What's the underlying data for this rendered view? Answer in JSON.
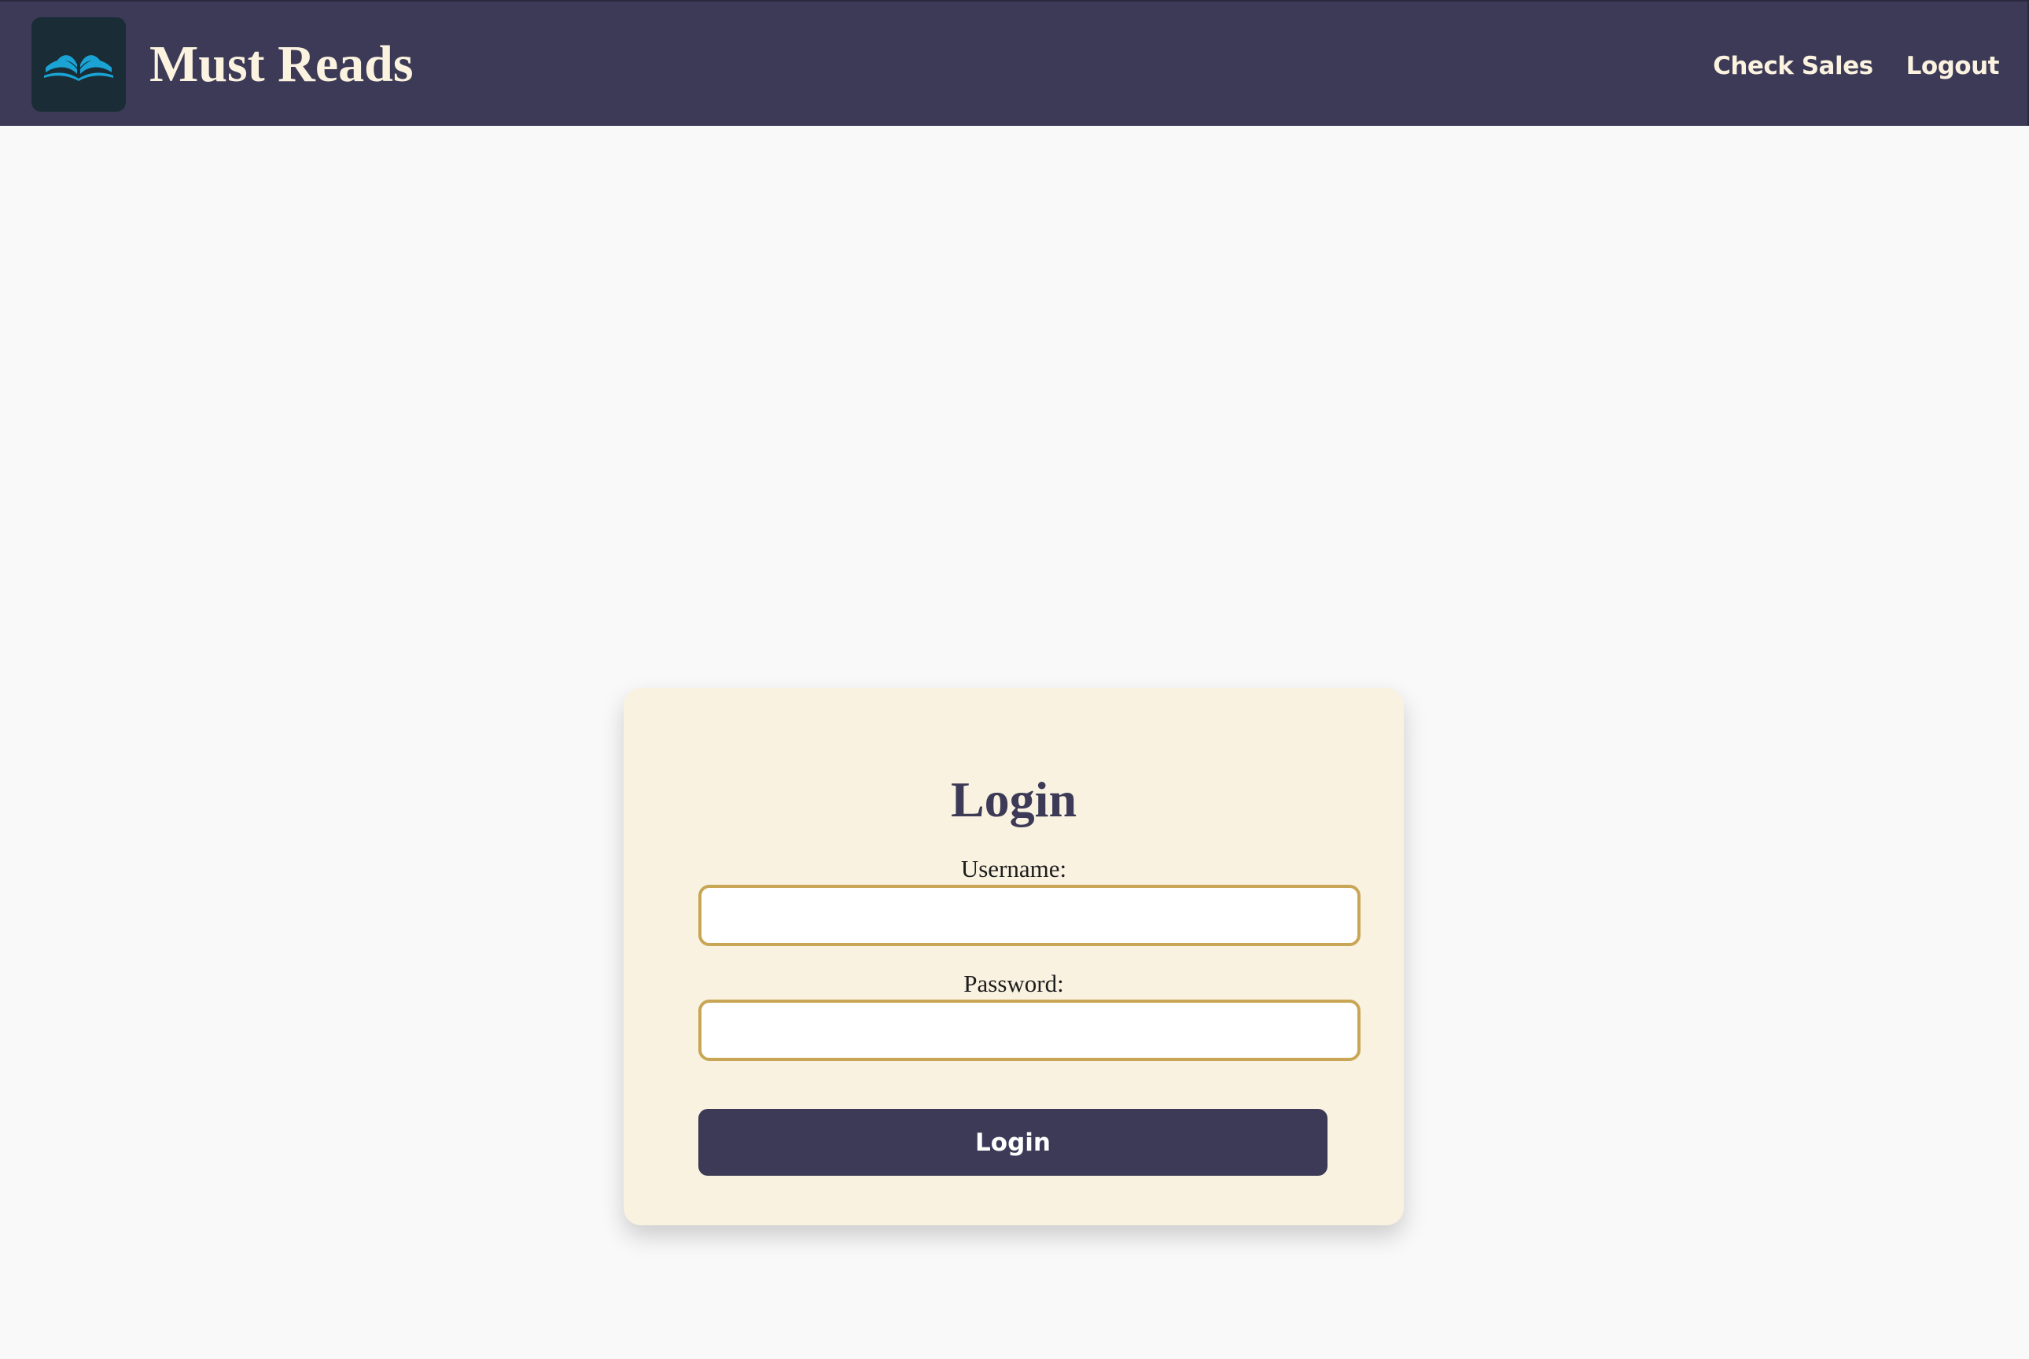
{
  "header": {
    "logo_icon": "open-book-icon",
    "title": "Must Reads",
    "nav": [
      {
        "label": "Check Sales"
      },
      {
        "label": "Logout"
      }
    ]
  },
  "login_form": {
    "title": "Login",
    "username_label": "Username:",
    "username_value": "",
    "password_label": "Password:",
    "password_value": "",
    "submit_label": "Login"
  },
  "colors": {
    "header_bg": "#3c3a56",
    "header_text": "#fbf3df",
    "logo_bg": "#1a2d36",
    "logo_accent": "#1aa3d4",
    "card_bg": "#f9f2e1",
    "input_border": "#c8a656",
    "button_bg": "#3c3a56",
    "page_bg": "#f9f9f9"
  }
}
